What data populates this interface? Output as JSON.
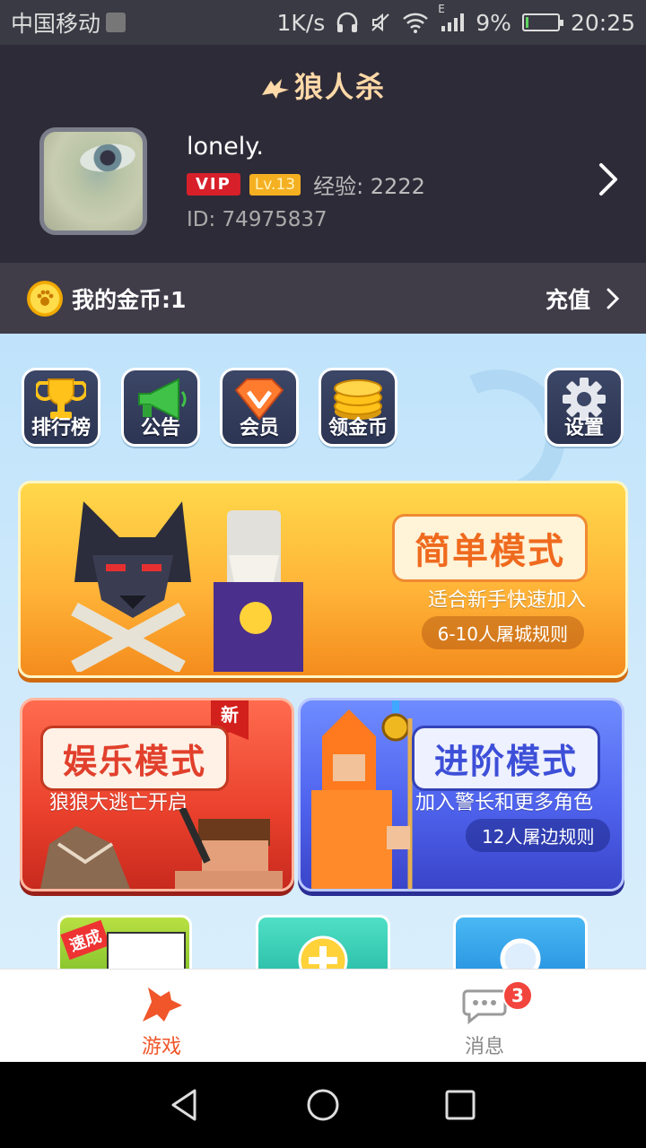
{
  "status_bar": {
    "carrier": "中国移动",
    "speed": "1K/s",
    "network_type": "E",
    "battery": "9%",
    "battery_level": 0.09,
    "time": "20:25"
  },
  "header": {
    "logo": "狼人杀",
    "username": "lonely.",
    "vip_badge": "VIP",
    "level_badge": "Lv.13",
    "experience": "经验: 2222",
    "user_id": "ID: 74975837"
  },
  "coins": {
    "label": "我的金币:1",
    "recharge_label": "充值"
  },
  "toolbar": {
    "items": [
      {
        "label": "排行榜",
        "icon": "trophy-icon"
      },
      {
        "label": "公告",
        "icon": "megaphone-icon"
      },
      {
        "label": "会员",
        "icon": "vip-gem-icon"
      },
      {
        "label": "领金币",
        "icon": "coins-stack-icon"
      },
      {
        "label": "设置",
        "icon": "gear-icon"
      }
    ]
  },
  "modes": {
    "easy": {
      "title": "简单模式",
      "subtitle": "适合新手快速加入",
      "rule": "6-10人屠城规则"
    },
    "fun": {
      "title": "娱乐模式",
      "subtitle": "狼狼大逃亡开启",
      "tag": "新"
    },
    "advanced": {
      "title": "进阶模式",
      "subtitle": "加入警长和更多角色",
      "rule": "12人屠边规则"
    }
  },
  "quick_tiles": {
    "tile1_label": "速成"
  },
  "bottom_nav": {
    "game_label": "游戏",
    "messages_label": "消息",
    "messages_badge": "3"
  },
  "colors": {
    "accent": "#f0562a",
    "header_bg": "#2e2b38",
    "vip_red": "#d7202a",
    "level_gold": "#f5b022"
  }
}
